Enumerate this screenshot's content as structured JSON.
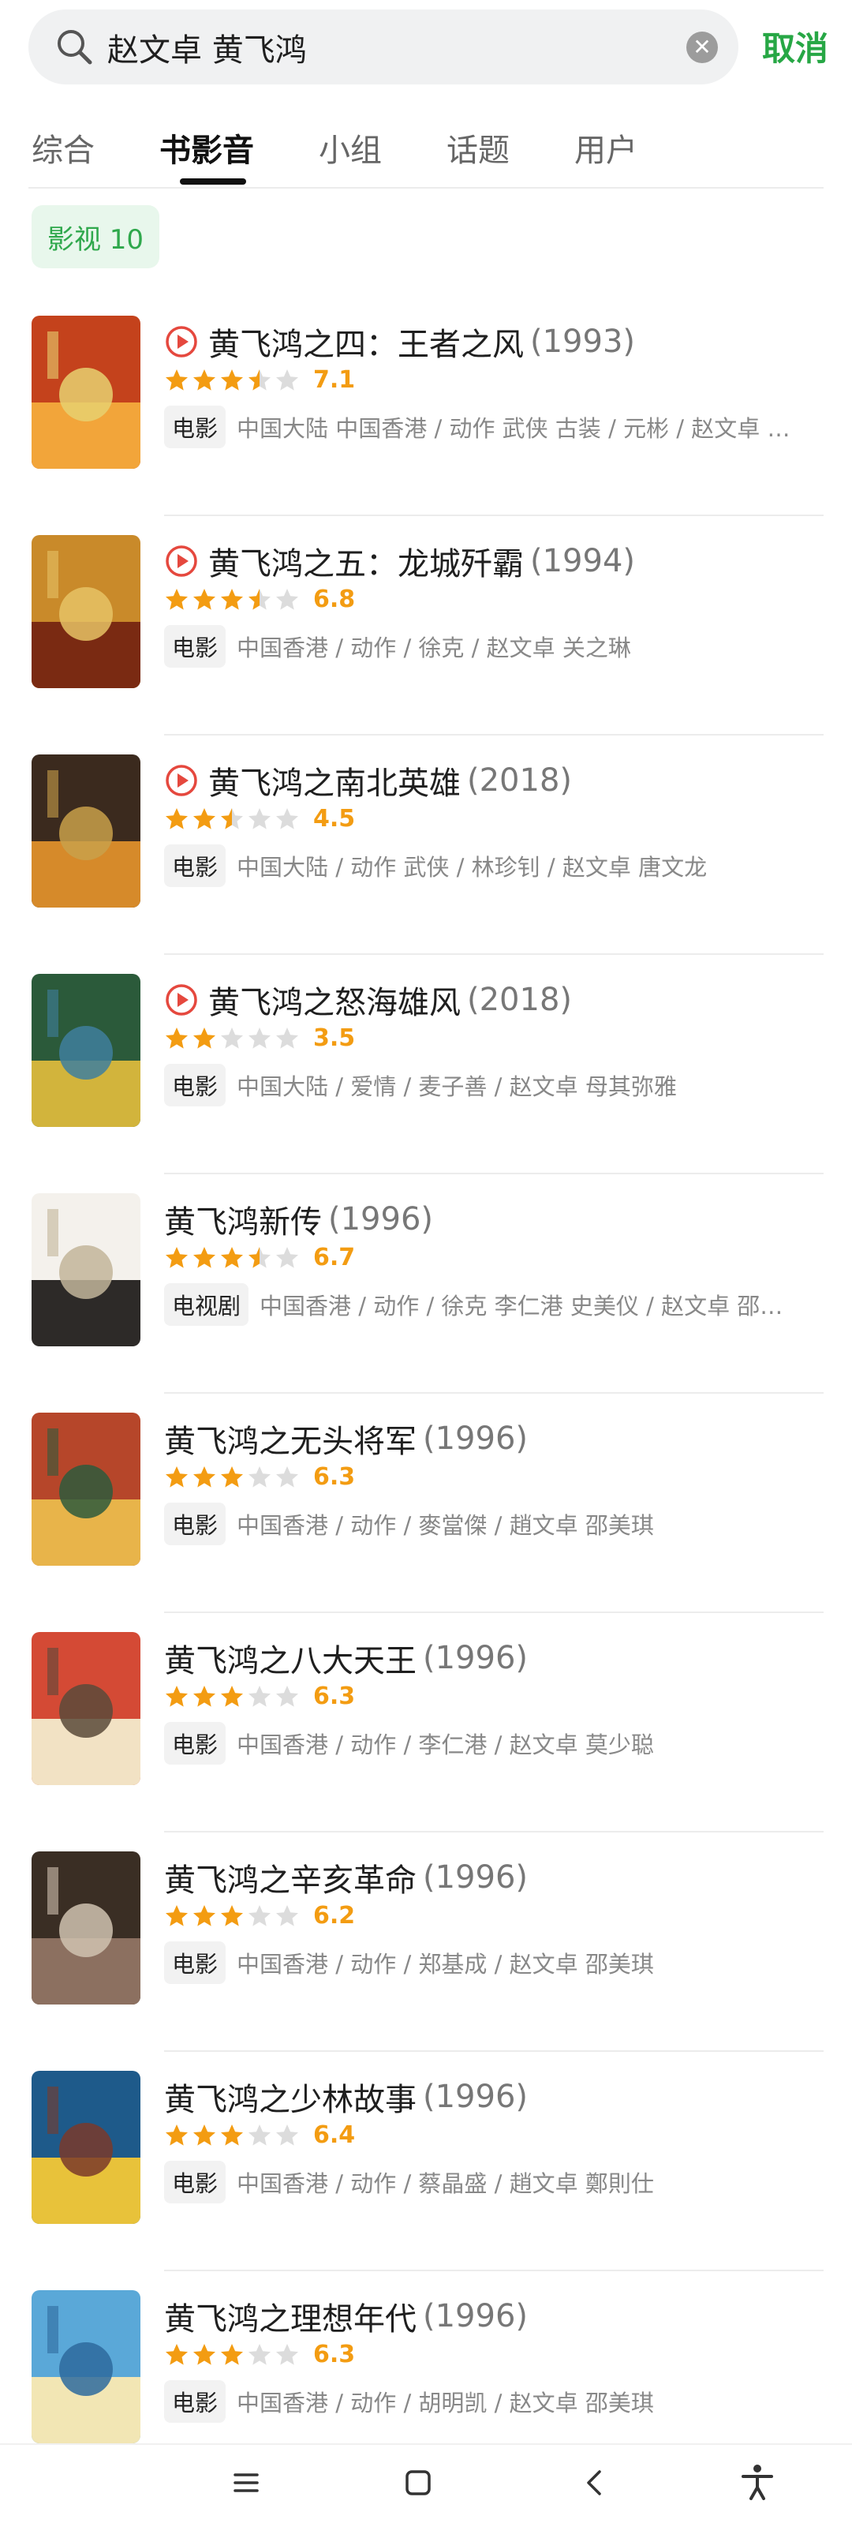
{
  "search": {
    "query": "赵文卓 黄飞鸿",
    "cancel_label": "取消"
  },
  "tabs": [
    {
      "label": "综合"
    },
    {
      "label": "书影音"
    },
    {
      "label": "小组"
    },
    {
      "label": "话题"
    },
    {
      "label": "用户"
    }
  ],
  "filter_chip": "影视 10",
  "colors": {
    "accent_green": "#27a745",
    "star_orange": "#f39c12",
    "play_red": "#e5483e"
  },
  "results": [
    {
      "title": "黄飞鸿之四：王者之风",
      "year": "(1993)",
      "rating": "7.1",
      "stars": 3.5,
      "playable": true,
      "type": "电影",
      "meta": "中国大陆 中国香港 / 动作 武侠 古装 / 元彬 / 赵文卓 …"
    },
    {
      "title": "黄飞鸿之五：龙城歼霸",
      "year": "(1994)",
      "rating": "6.8",
      "stars": 3.5,
      "playable": true,
      "type": "电影",
      "meta": "中国香港 / 动作 / 徐克 / 赵文卓 关之琳"
    },
    {
      "title": "黄飞鸿之南北英雄",
      "year": "(2018)",
      "rating": "4.5",
      "stars": 2.5,
      "playable": true,
      "type": "电影",
      "meta": "中国大陆 / 动作 武侠 / 林珍钊 / 赵文卓 唐文龙"
    },
    {
      "title": "黄飞鸿之怒海雄风",
      "year": "(2018)",
      "rating": "3.5",
      "stars": 2,
      "playable": true,
      "type": "电影",
      "meta": "中国大陆 / 爱情 / 麦子善 / 赵文卓 母其弥雅"
    },
    {
      "title": "黄飞鸿新传",
      "year": "(1996)",
      "rating": "6.7",
      "stars": 3.5,
      "playable": false,
      "type": "电视剧",
      "meta": "中国香港 / 动作 / 徐克 李仁港 史美仪 / 赵文卓 邵…"
    },
    {
      "title": "黄飞鸿之无头将军",
      "year": "(1996)",
      "rating": "6.3",
      "stars": 3,
      "playable": false,
      "type": "电影",
      "meta": "中国香港 / 动作 / 麥當傑 / 趙文卓 邵美琪"
    },
    {
      "title": "黄飞鸿之八大天王",
      "year": "(1996)",
      "rating": "6.3",
      "stars": 3,
      "playable": false,
      "type": "电影",
      "meta": "中国香港 / 动作 / 李仁港 / 赵文卓 莫少聪"
    },
    {
      "title": "黄飞鸿之辛亥革命",
      "year": "(1996)",
      "rating": "6.2",
      "stars": 3,
      "playable": false,
      "type": "电影",
      "meta": "中国香港 / 动作 / 郑基成 / 赵文卓 邵美琪"
    },
    {
      "title": "黄飞鸿之少林故事",
      "year": "(1996)",
      "rating": "6.4",
      "stars": 3,
      "playable": false,
      "type": "电影",
      "meta": "中国香港 / 动作 / 蔡晶盛 / 趙文卓 鄭則仕"
    },
    {
      "title": "黄飞鸿之理想年代",
      "year": "(1996)",
      "rating": "6.3",
      "stars": 3,
      "playable": false,
      "type": "电影",
      "meta": "中国香港 / 动作 / 胡明凯 / 赵文卓 邵美琪"
    }
  ],
  "nav": [
    {
      "icon": "menu-icon"
    },
    {
      "icon": "home-icon"
    },
    {
      "icon": "back-icon"
    },
    {
      "icon": "accessibility-icon"
    }
  ]
}
